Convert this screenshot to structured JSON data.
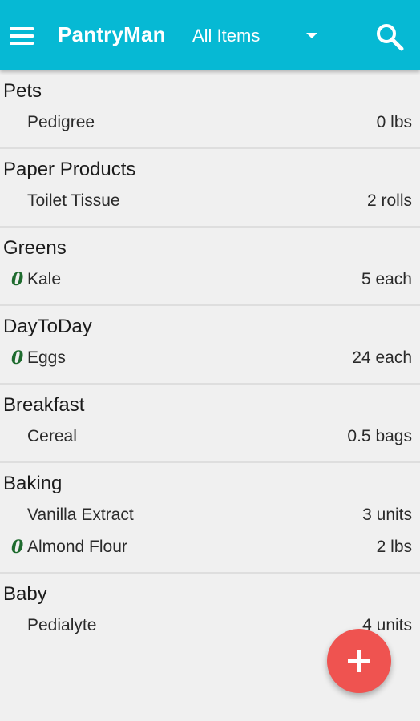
{
  "header": {
    "title": "PantryMan",
    "filter_label": "All Items",
    "menu_icon": "hamburger-menu-icon",
    "search_icon": "search-icon",
    "background_color": "#06b9d4"
  },
  "categories": [
    {
      "name": "Pets",
      "items": [
        {
          "name": "Pedigree",
          "qty": "0 lbs",
          "marked": false
        }
      ]
    },
    {
      "name": "Paper Products",
      "items": [
        {
          "name": "Toilet Tissue",
          "qty": "2 rolls",
          "marked": false
        }
      ]
    },
    {
      "name": "Greens",
      "items": [
        {
          "name": "Kale",
          "qty": "5 each",
          "marked": true
        }
      ]
    },
    {
      "name": "DayToDay",
      "items": [
        {
          "name": "Eggs",
          "qty": "24 each",
          "marked": true
        }
      ]
    },
    {
      "name": "Breakfast",
      "items": [
        {
          "name": "Cereal",
          "qty": "0.5 bags",
          "marked": false
        }
      ]
    },
    {
      "name": "Baking",
      "items": [
        {
          "name": "Vanilla Extract",
          "qty": "3 units",
          "marked": false
        },
        {
          "name": "Almond Flour",
          "qty": "2 lbs",
          "marked": true
        }
      ]
    },
    {
      "name": "Baby",
      "items": [
        {
          "name": "Pedialyte",
          "qty": "4 units",
          "marked": false
        }
      ]
    }
  ],
  "item_mark_glyph": "0",
  "fab": {
    "icon": "plus-icon",
    "color": "#ef5350"
  }
}
